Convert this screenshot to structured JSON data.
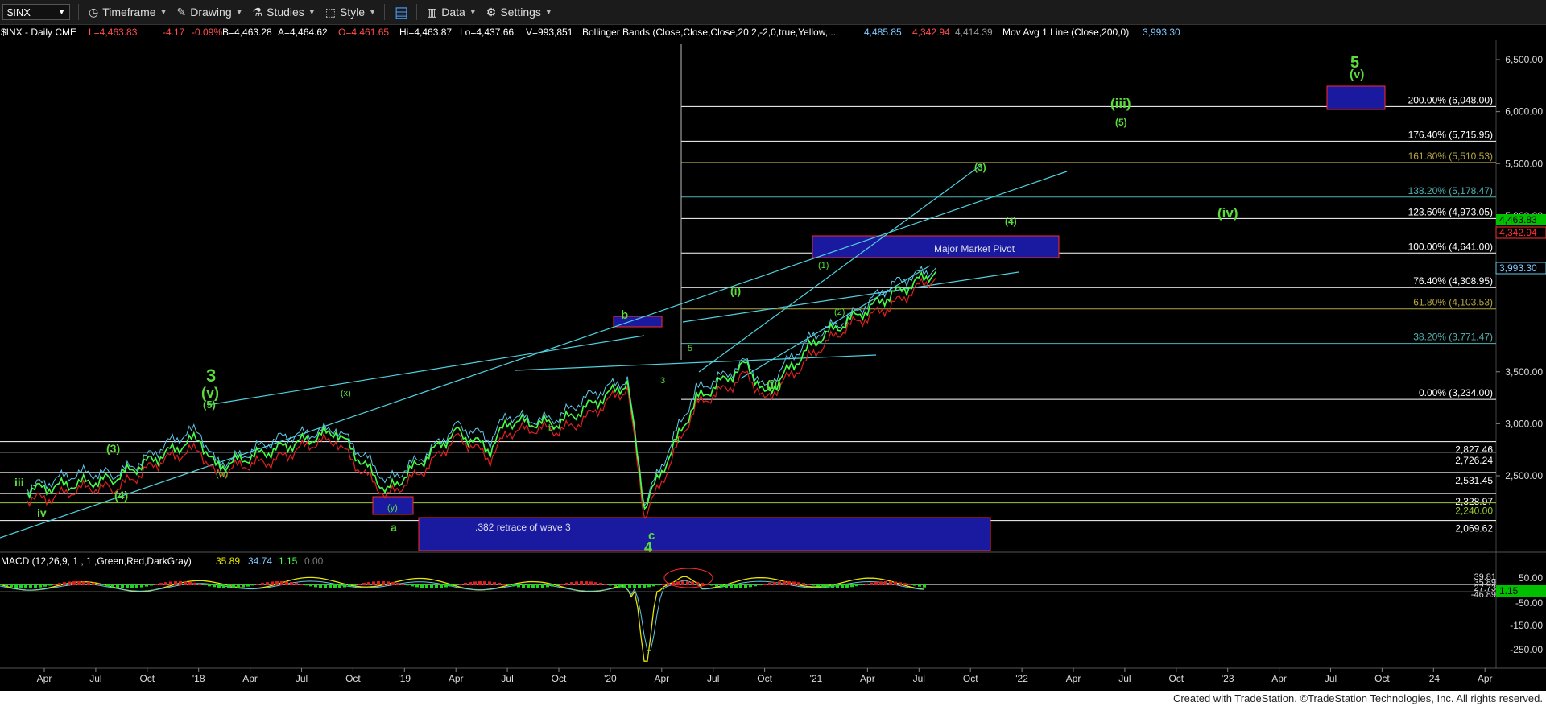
{
  "toolbar": {
    "symbol": "$INX",
    "timeframe": "Timeframe",
    "drawing": "Drawing",
    "studies": "Studies",
    "style": "Style",
    "data": "Data",
    "settings": "Settings"
  },
  "status_line": {
    "symbol": "$INX - Daily  CME",
    "low": "L=4,463.83",
    "change": "-4.17",
    "change_pct": "-0.09%",
    "bid": "B=4,463.28",
    "ask": "A=4,464.62",
    "open": "O=4,461.65",
    "high": "Hi=4,463.87",
    "lo": "Lo=4,437.66",
    "volume": "V=993,851",
    "bb_label": "Bollinger Bands (Close,Close,Close,20,2,-2,0,true,Yellow,...",
    "bb_upper": "4,485.85",
    "bb_lower": "4,342.94",
    "bb_mid": "4,414.39",
    "ma_label": "Mov Avg 1 Line (Close,200,0)",
    "ma_value": "3,993.30"
  },
  "price_axis": {
    "ticks": [
      "6,500.00",
      "6,000.00",
      "5,500.00",
      "5,000.00",
      "3,500.00",
      "3,000.00",
      "2,500.00"
    ],
    "badges": {
      "last": "4,463.83",
      "bb_lower": "4,342.94",
      "ma": "3,993.30"
    }
  },
  "fib_levels": [
    {
      "label": "200.00% (6,048.00)",
      "value": 6048.0,
      "color": "#ffffff"
    },
    {
      "label": "176.40% (5,715.95)",
      "value": 5715.95,
      "color": "#ffffff"
    },
    {
      "label": "161.80% (5,510.53)",
      "value": 5510.53,
      "color": "#b5a642"
    },
    {
      "label": "138.20% (5,178.47)",
      "value": 5178.47,
      "color": "#4fb3b3"
    },
    {
      "label": "123.60% (4,973.05)",
      "value": 4973.05,
      "color": "#ffffff"
    },
    {
      "label": "100.00% (4,641.00)",
      "value": 4641.0,
      "color": "#ffffff"
    },
    {
      "label": "76.40% (4,308.95)",
      "value": 4308.95,
      "color": "#ffffff"
    },
    {
      "label": "61.80% (4,103.53)",
      "value": 4103.53,
      "color": "#b5a642"
    },
    {
      "label": "38.20% (3,771.47)",
      "value": 3771.47,
      "color": "#4fb3b3"
    },
    {
      "label": "0.00% (3,234.00)",
      "value": 3234.0,
      "color": "#ffffff"
    }
  ],
  "support_levels": [
    {
      "label": "2,827.46",
      "value": 2827.46,
      "color": "#ffffff"
    },
    {
      "label": "2,726.24",
      "value": 2726.24,
      "color": "#ffffff"
    },
    {
      "label": "2,531.45",
      "value": 2531.45,
      "color": "#ffffff"
    },
    {
      "label": "2,328.97",
      "value": 2328.97,
      "color": "#ffffff"
    },
    {
      "label": "2,240.00",
      "value": 2240.0,
      "color": "#9acd32"
    },
    {
      "label": "2,069.62",
      "value": 2069.62,
      "color": "#ffffff"
    }
  ],
  "boxes": {
    "pivot": "Major Market Pivot",
    "retrace": ".382 retrace of wave 3"
  },
  "wave_labels": {
    "five": "5",
    "v_top": "(v)",
    "iii_top": "(iii)",
    "five_paren": "(5)",
    "three_paren": "(3)",
    "four_paren": "(4)",
    "iv": "(iv)",
    "i": "(i)",
    "ii": "(ii)",
    "b": "b",
    "c": "c",
    "a": "a",
    "four": "4",
    "three": "3",
    "v_mid": "(v)",
    "five_mid": "(5)",
    "x": "(x)",
    "w": "(w)",
    "y": "(y)",
    "three_small": "(3)",
    "four_small": "(4)",
    "iii_small": "iii",
    "iv_small": "iv",
    "one_p": "(1)",
    "two_p": "(2)",
    "wave_3": "3",
    "wave_5": "5",
    "wave_4": "4",
    "lower_b": "b"
  },
  "macd": {
    "label": "MACD (12,26,9, 1 , 1 ,Green,Red,DarkGray)",
    "v1": "35.89",
    "v2": "34.74",
    "v3": "1.15",
    "v4": "0.00",
    "ticks": [
      "50.00",
      "-50.00",
      "-150.00",
      "-250.00"
    ],
    "stack": [
      "39.81",
      "35.89",
      "27.73",
      "-46.89"
    ],
    "badge": "1.15"
  },
  "time_axis": [
    "Apr",
    "Jul",
    "Oct",
    "'18",
    "Apr",
    "Jul",
    "Oct",
    "'19",
    "Apr",
    "Jul",
    "Oct",
    "'20",
    "Apr",
    "Jul",
    "Oct",
    "'21",
    "Apr",
    "Jul",
    "Oct",
    "'22",
    "Apr",
    "Jul",
    "Oct",
    "'23",
    "Apr",
    "Jul",
    "Oct",
    "'24",
    "Apr"
  ],
  "footer": "Created with TradeStation. ©TradeStation Technologies, Inc. All rights reserved.",
  "chart_data": {
    "type": "line",
    "title": "$INX - Daily",
    "series": [
      {
        "name": "$INX",
        "x": [
          "2017-03",
          "2017-08",
          "2018-01",
          "2018-02",
          "2018-09",
          "2018-12",
          "2019-04",
          "2019-06",
          "2019-07",
          "2019-10",
          "2020-02",
          "2020-03",
          "2020-06",
          "2020-09",
          "2020-10",
          "2021-01",
          "2021-05",
          "2021-08"
        ],
        "values": [
          2360,
          2470,
          2870,
          2580,
          2930,
          2350,
          2930,
          2750,
          3020,
          3000,
          3390,
          2200,
          3230,
          3580,
          3270,
          3800,
          4200,
          4464
        ]
      }
    ],
    "ylim": [
      2000,
      6600
    ],
    "xlabel": "",
    "ylabel": ""
  }
}
